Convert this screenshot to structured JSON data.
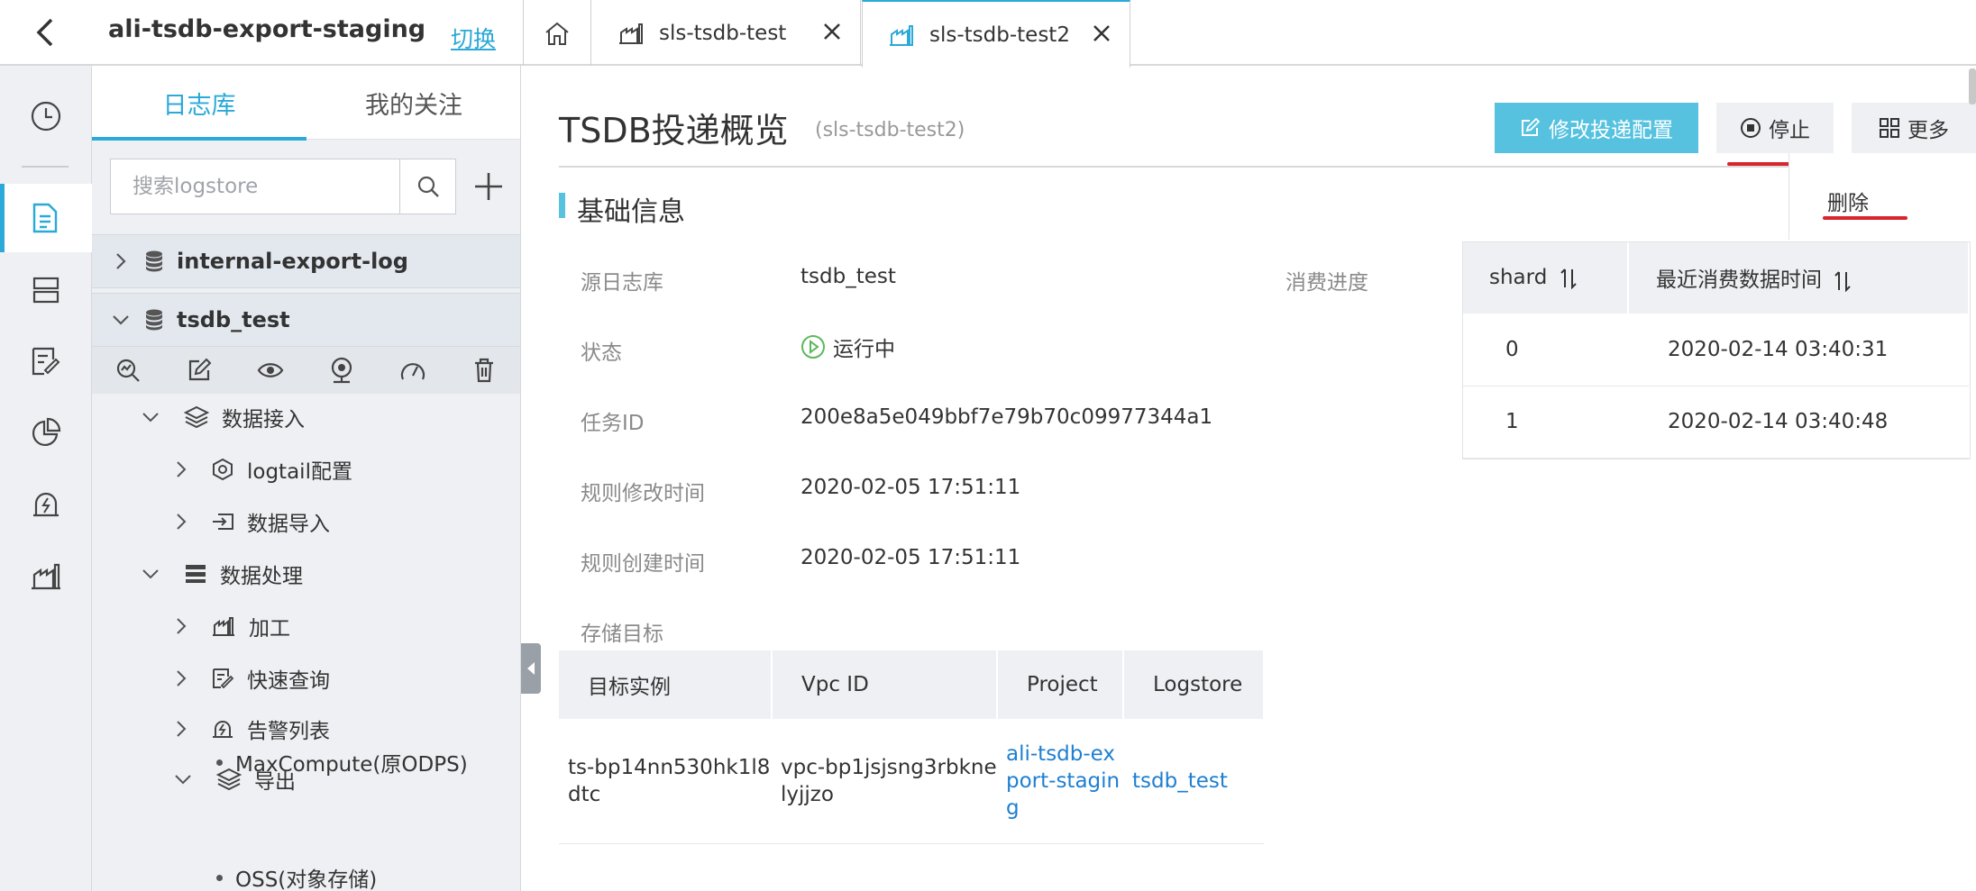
{
  "header": {
    "project_name": "ali-tsdb-export-staging",
    "switch_label": "切换",
    "tabs": [
      {
        "label": "sls-tsdb-test",
        "active": false
      },
      {
        "label": "sls-tsdb-test2",
        "active": true
      }
    ]
  },
  "sidebar": {
    "tabs": [
      {
        "label": "日志库",
        "active": true
      },
      {
        "label": "我的关注",
        "active": false
      }
    ],
    "search_placeholder": "搜索logstore",
    "logstores": [
      {
        "name": "internal-export-log",
        "expanded": false
      },
      {
        "name": "tsdb_test",
        "expanded": true
      }
    ],
    "tree": {
      "data_ingest": "数据接入",
      "logtail_config": "logtail配置",
      "data_import": "数据导入",
      "data_process": "数据处理",
      "transform": "加工",
      "quick_query": "快速查询",
      "alert_list": "告警列表",
      "export": "导出",
      "maxcompute": "MaxCompute(原ODPS)",
      "oss": "OSS(对象存储)"
    }
  },
  "main": {
    "title": "TSDB投递概览",
    "subtitle": "(sls-tsdb-test2)",
    "buttons": {
      "edit": "修改投递配置",
      "stop": "停止",
      "more": "更多",
      "delete": "删除"
    },
    "section_title": "基础信息",
    "fields": [
      {
        "label": "源日志库",
        "value": "tsdb_test"
      },
      {
        "label": "状态",
        "value": "运行中"
      },
      {
        "label": "任务ID",
        "value": "200e8a5e049bbf7e79b70c09977344a1"
      },
      {
        "label": "规则修改时间",
        "value": "2020-02-05 17:51:11"
      },
      {
        "label": "规则创建时间",
        "value": "2020-02-05 17:51:11"
      }
    ],
    "storage_label": "存储目标",
    "storage_table": {
      "headers": [
        "目标实例",
        "Vpc ID",
        "Project",
        "Logstore"
      ],
      "row": [
        "ts-bp14nn530hk1l8dtc",
        "vpc-bp1jsjsng3rbknelyjjzo",
        "ali-tsdb-export-staging",
        "tsdb_test"
      ]
    },
    "progress_label": "消费进度",
    "progress_table": {
      "headers": [
        "shard",
        "最近消费数据时间"
      ],
      "rows": [
        [
          "0",
          "2020-02-14 03:40:31"
        ],
        [
          "1",
          "2020-02-14 03:40:48"
        ]
      ]
    }
  },
  "colors": {
    "accent": "#2ba9d8",
    "primary_button": "#56c2e0",
    "link": "#1e7fd1",
    "annotation_red": "#d9232d",
    "running_green": "#5cb85c"
  }
}
